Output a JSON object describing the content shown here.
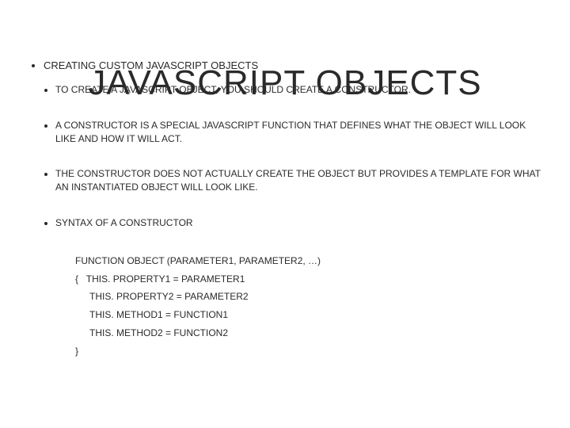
{
  "watermark": "JAVASCRIPT OBJECTS",
  "heading": "CREATING CUSTOM JAVASCRIPT OBJECTS",
  "bullets": {
    "b1": "TO CREATE A JAVASCRIPT OBJECT, YOU SHOULD CREATE A CONSTRUCTOR.",
    "b2": "A CONSTRUCTOR IS A SPECIAL JAVASCRIPT FUNCTION THAT DEFINES WHAT THE OBJECT WILL LOOK LIKE AND HOW IT WILL ACT.",
    "b3": "THE CONSTRUCTOR DOES NOT ACTUALLY CREATE THE OBJECT BUT PROVIDES A TEMPLATE FOR WHAT AN INSTANTIATED OBJECT WILL LOOK LIKE.",
    "b4": "SYNTAX OF A CONSTRUCTOR"
  },
  "code": {
    "l1": "FUNCTION OBJECT (PARAMETER1, PARAMETER2, …)",
    "l2": "{   THIS. PROPERTY1 = PARAMETER1",
    "l3": "THIS. PROPERTY2 = PARAMETER2",
    "l4": "THIS. METHOD1 = FUNCTION1",
    "l5": "THIS. METHOD2 = FUNCTION2",
    "l6": "}"
  }
}
